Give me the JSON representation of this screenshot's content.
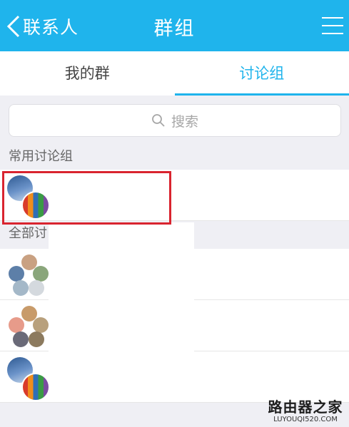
{
  "header": {
    "back_label": "联系人",
    "title": "群组",
    "back_icon": "chevron-left-icon",
    "menu_icon": "hamburger-menu-icon"
  },
  "tabs": [
    {
      "label": "我的群",
      "active": false
    },
    {
      "label": "讨论组",
      "active": true
    }
  ],
  "search": {
    "placeholder": "搜索",
    "icon": "search-icon"
  },
  "sections": {
    "common": {
      "label": "常用讨论组"
    },
    "all": {
      "label": "全部讨"
    }
  },
  "watermark": {
    "text": "路由器之家",
    "url": "LUYOUQI520.COM"
  },
  "colors": {
    "accent": "#1fb4ec",
    "highlight": "#d9242f",
    "background": "#efeff4"
  }
}
